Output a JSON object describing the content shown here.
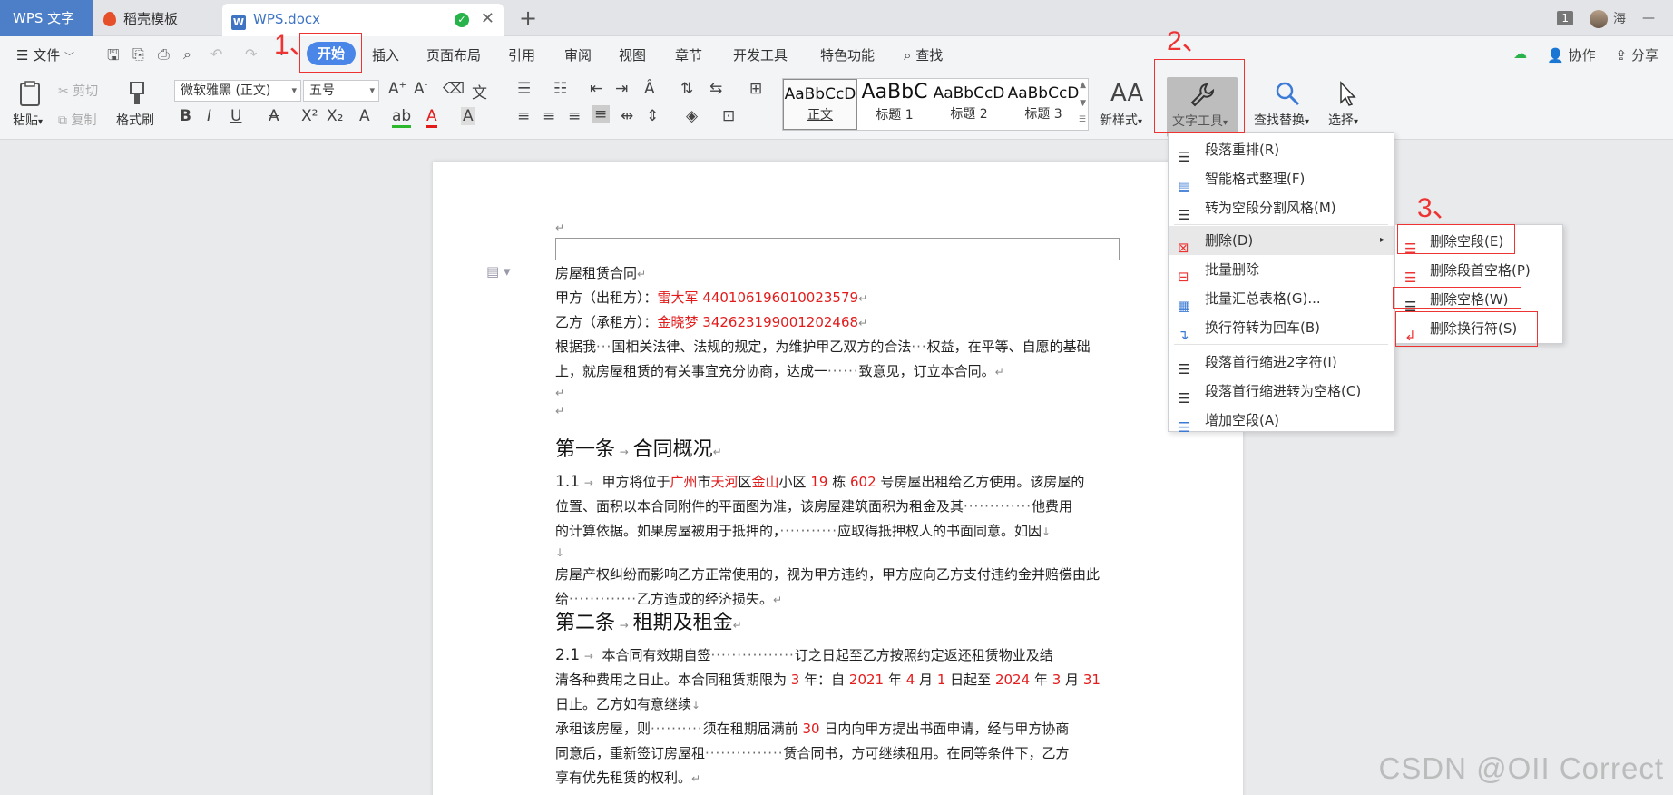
{
  "titlebar": {
    "app_name": "WPS 文字",
    "tabs": [
      {
        "label": "稻壳模板"
      },
      {
        "label": "WPS.docx"
      }
    ],
    "window_count": "1",
    "user_name": "海"
  },
  "menubar": {
    "file": "文件",
    "tabs": [
      "开始",
      "插入",
      "页面布局",
      "引用",
      "审阅",
      "视图",
      "章节",
      "开发工具",
      "特色功能"
    ],
    "search": "查找",
    "collab": "协作",
    "share": "分享"
  },
  "ribbon": {
    "paste": "粘贴",
    "cut": "剪切",
    "copy": "复制",
    "format_painter": "格式刷",
    "font_name": "微软雅黑 (正文)",
    "font_size": "五号",
    "styles": [
      {
        "sample": "AaBbCcD",
        "name": "正文"
      },
      {
        "sample": "AaBbC",
        "name": "标题 1"
      },
      {
        "sample": "AaBbCcD",
        "name": "标题 2"
      },
      {
        "sample": "AaBbCcD",
        "name": "标题 3"
      }
    ],
    "new_style": "新样式",
    "text_tools": "文字工具",
    "find_replace": "查找替换",
    "select": "选择"
  },
  "annotations": {
    "step1": "1、",
    "step2": "2、",
    "step3": "3、"
  },
  "dropdown": {
    "items": [
      "段落重排(R)",
      "智能格式整理(F)",
      "转为空段分割风格(M)",
      "删除(D)",
      "批量删除",
      "批量汇总表格(G)...",
      "换行符转为回车(B)",
      "段落首行缩进2字符(I)",
      "段落首行缩进转为空格(C)",
      "增加空段(A)"
    ]
  },
  "submenu": {
    "items": [
      "删除空段(E)",
      "删除段首空格(P)",
      "删除空格(W)",
      "删除换行符(S)"
    ]
  },
  "document": {
    "title": "房屋租赁合同",
    "party_a_label": "甲方（出租方）：",
    "party_a": "雷大军 440106196010023579",
    "party_b_label": "乙方（承租方）：",
    "party_b": "金晓梦 342623199001202468",
    "intro_1a": "根据我",
    "intro_1b": "国相关法律、法规的规定，为维护甲乙双方的合法",
    "intro_1c": "权益，在平等、自愿的基础",
    "intro_2a": "上，就房屋租赁的有关事宜充分协商，达成一",
    "intro_2b": "致意见，订立本合同。",
    "art1_title": "第一条",
    "art1_name": "合同概况",
    "art1_num": "1.1",
    "art1_l1a": "甲方将位于",
    "city": "广州",
    "art1_l1b": "市",
    "district": "天河",
    "art1_l1c": "区",
    "community": "金山",
    "art1_l1d": "小区",
    "building": "19",
    "art1_l1e": "栋",
    "room": "602",
    "art1_l1f": "号房屋出租给乙方使用。该房屋的",
    "art1_l2a": "位置、面积以本合同附件的平面图为准，该房屋建筑面积为租金及其",
    "art1_l2b": "他费用",
    "art1_l3a": "的计算依据。如果房屋被用于抵押的，",
    "art1_l3b": "应取得抵押权人的书面同意。如因",
    "art1_l4": "房屋产权纠纷而影响乙方正常使用的，视为甲方违约，甲方应向乙方支付违约金并赔偿由此",
    "art1_l5a": "给",
    "art1_l5b": "乙方造成的经济损失。",
    "art2_title": "第二条",
    "art2_name": "租期及租金",
    "art2_num": "2.1",
    "art2_l1a": "本合同有效期自签",
    "art2_l1b": "订之日起至乙方按照约定返还租赁物业及结",
    "art2_l2a": "清各种费用之日止。本合同租赁期限为",
    "lease_years": "3",
    "art2_l2b": "年：自",
    "start_year": "2021",
    "art2_l2c": "年",
    "start_month": "4",
    "art2_l2d": "月",
    "start_day": "1",
    "art2_l2e": "日起至",
    "end_year": "2024",
    "art2_l2f": "年",
    "end_month": "3",
    "art2_l2g": "月",
    "end_day": "31",
    "art2_l3": "日止。乙方如有意继续",
    "art2_l4a": "承租该房屋，则",
    "art2_l4b": "须在租期届满前",
    "notice_days": "30",
    "art2_l4c": "日内向甲方提出书面申请，经与甲方协商",
    "art2_l5a": "同意后，重新签订房屋租",
    "art2_l5b": "赁合同书，方可继续租用。在同等条件下，乙方",
    "art2_l6": "享有优先租赁的权利。"
  },
  "watermark": "CSDN @OII Correct"
}
